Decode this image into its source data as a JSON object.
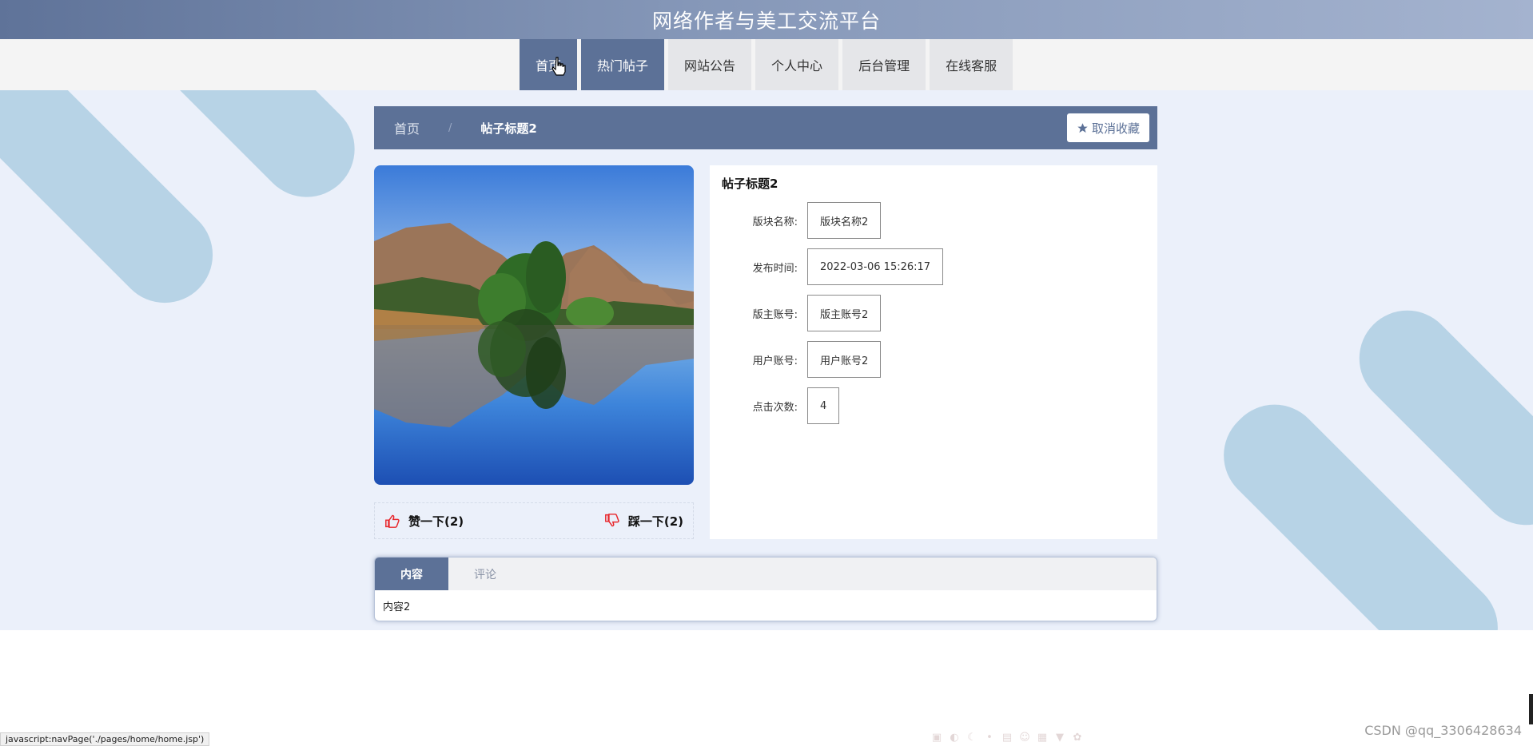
{
  "site": {
    "title": "网络作者与美工交流平台"
  },
  "nav": {
    "items": [
      {
        "label": "首页",
        "active": true
      },
      {
        "label": "热门帖子",
        "active": true
      },
      {
        "label": "网站公告",
        "active": false
      },
      {
        "label": "个人中心",
        "active": false
      },
      {
        "label": "后台管理",
        "active": false
      },
      {
        "label": "在线客服",
        "active": false
      }
    ]
  },
  "breadcrumb": {
    "home": "首页",
    "separator": "/",
    "current": "帖子标题2"
  },
  "favorite_button": {
    "icon": "star-icon",
    "label": "取消收藏"
  },
  "votes": {
    "like": {
      "icon": "thumbs-up-icon",
      "label": "赞一下(2)"
    },
    "dislike": {
      "icon": "thumbs-down-icon",
      "label": "踩一下(2)"
    }
  },
  "post": {
    "title": "帖子标题2",
    "fields": [
      {
        "label": "版块名称:",
        "value": "版块名称2"
      },
      {
        "label": "发布时间:",
        "value": "2022-03-06 15:26:17"
      },
      {
        "label": "版主账号:",
        "value": "版主账号2"
      },
      {
        "label": "用户账号:",
        "value": "用户账号2"
      },
      {
        "label": "点击次数:",
        "value": "4"
      }
    ]
  },
  "tabs": {
    "items": [
      {
        "label": "内容",
        "active": true
      },
      {
        "label": "评论",
        "active": false
      }
    ],
    "content": "内容2"
  },
  "status_bar": {
    "text": "javascript:navPage('./pages/home/home.jsp')"
  },
  "watermark": {
    "text": "CSDN @qq_3306428634"
  },
  "colors": {
    "primary": "#5c7197",
    "page_bg": "#ebf0fa",
    "stripe": "#b7d3e6",
    "vote_icon": "#e8262b"
  }
}
